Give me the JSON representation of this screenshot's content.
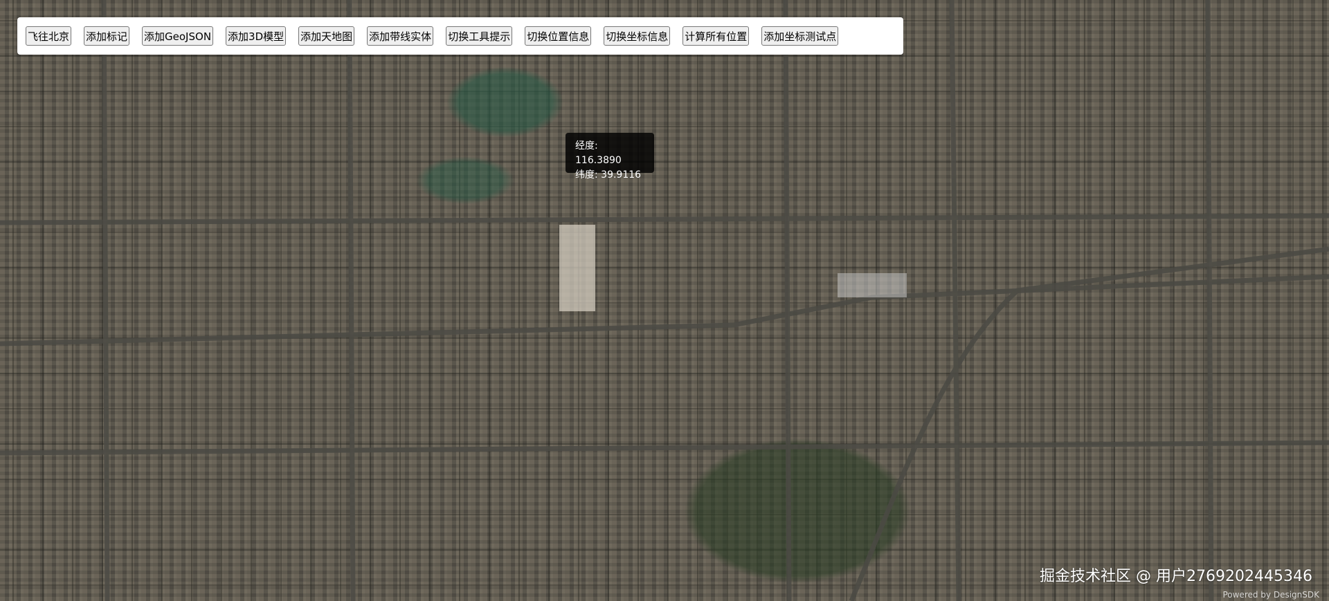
{
  "toolbar": {
    "buttons": [
      "飞往北京",
      "添加标记",
      "添加GeoJSON",
      "添加3D模型",
      "添加天地图",
      "添加带线实体",
      "切换工具提示",
      "切换位置信息",
      "切换坐标信息",
      "计算所有位置",
      "添加坐标测试点"
    ]
  },
  "tooltip": {
    "longitude": "经度: 116.3890",
    "latitude": "纬度: 39.9116"
  },
  "watermark": "掘金技术社区 @ 用户2769202445346",
  "credit": "Powered by DesignSDK"
}
